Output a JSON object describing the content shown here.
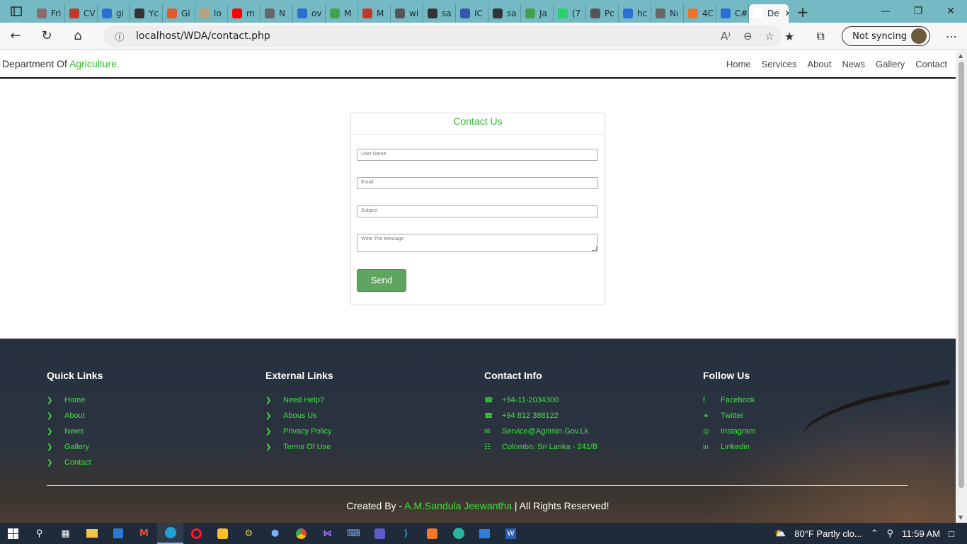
{
  "browser": {
    "tabs": [
      {
        "label": "Fri",
        "color": "#8a6a6a"
      },
      {
        "label": "CV",
        "color": "#c0392b"
      },
      {
        "label": "gi",
        "color": "#2a6fd6"
      },
      {
        "label": "Yc",
        "color": "#333333"
      },
      {
        "label": "Gi",
        "color": "#e05a2a"
      },
      {
        "label": "lo",
        "color": "#b9a27a"
      },
      {
        "label": "m",
        "color": "#ff0000"
      },
      {
        "label": "N",
        "color": "#666666"
      },
      {
        "label": "ov",
        "color": "#2a6fd6"
      },
      {
        "label": "M",
        "color": "#3fa34d"
      },
      {
        "label": "M",
        "color": "#c0392b"
      },
      {
        "label": "wi",
        "color": "#555555"
      },
      {
        "label": "sa",
        "color": "#333333"
      },
      {
        "label": "IC",
        "color": "#3355aa"
      },
      {
        "label": "sa",
        "color": "#333333"
      },
      {
        "label": "Ja",
        "color": "#3fa34d"
      },
      {
        "label": "(7",
        "color": "#25d366"
      },
      {
        "label": "Pc",
        "color": "#555555"
      },
      {
        "label": "hc",
        "color": "#2a6fd6"
      },
      {
        "label": "Nı",
        "color": "#666666"
      },
      {
        "label": "4C",
        "color": "#e8732a"
      },
      {
        "label": "C#",
        "color": "#2a6fd6"
      },
      {
        "label": "De",
        "color": "#ffffff"
      }
    ],
    "url": "localhost/WDA/contact.php",
    "sync_label": "Not syncing"
  },
  "site": {
    "brand_prefix": "Department Of ",
    "brand_accent": "Agriculture.",
    "nav": [
      "Home",
      "Services",
      "About",
      "News",
      "Gallery",
      "Contact"
    ]
  },
  "contact_form": {
    "title": "Contact Us",
    "username_placeholder": "User Name",
    "email_placeholder": "Email",
    "subject_placeholder": "Subject",
    "message_placeholder": "Write The Message",
    "send_label": "Send"
  },
  "footer": {
    "quick_links": {
      "heading": "Quick Links",
      "items": [
        "Home",
        "About",
        "News",
        "Gallery",
        "Contact"
      ]
    },
    "external_links": {
      "heading": "External Links",
      "items": [
        "Need Help?",
        "Abous Us",
        "Privacy Policy",
        "Terms Of Use"
      ]
    },
    "contact_info": {
      "heading": "Contact Info",
      "items": [
        {
          "icon": "phone-icon",
          "text": "+94-11-2034300"
        },
        {
          "icon": "phone-icon",
          "text": "+94 812 388122"
        },
        {
          "icon": "envelope-icon",
          "text": "Service@Agrimin.Gov.Lk"
        },
        {
          "icon": "map-icon",
          "text": "Colombo, Sri Lanka - 241/B"
        }
      ]
    },
    "follow_us": {
      "heading": "Follow Us",
      "items": [
        {
          "icon": "facebook-icon",
          "text": "Facebook"
        },
        {
          "icon": "twitter-icon",
          "text": "Twitter"
        },
        {
          "icon": "instagram-icon",
          "text": "Instagram"
        },
        {
          "icon": "linkedin-icon",
          "text": "Linkedin"
        }
      ]
    },
    "credits_prefix": "Created By - ",
    "credits_name": "A.M.Sandula Jeewantha",
    "credits_suffix": " | All Rights Reserved!"
  },
  "taskbar": {
    "weather": "80°F  Partly clo...",
    "time": "11:59 AM"
  },
  "colors": {
    "accent_green": "#32b832",
    "footer_link_green": "#3fe03f",
    "send_button": "#5fa55f",
    "tabbar": "#74b9c4"
  }
}
